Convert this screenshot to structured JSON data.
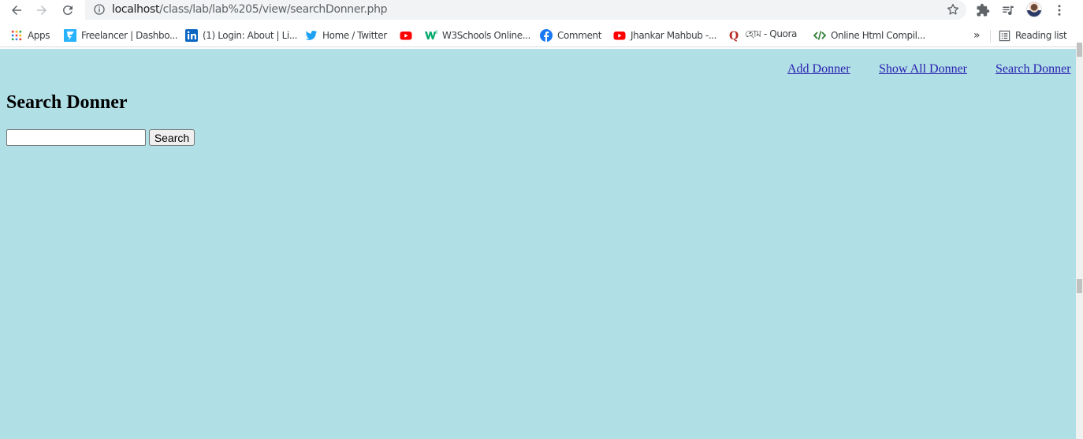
{
  "browser": {
    "url_host": "localhost",
    "url_path": "/class/lab/lab%205/view/searchDonner.php",
    "bookmarks": [
      {
        "label": "Apps",
        "icon": "apps-grid-icon"
      },
      {
        "label": "Freelancer | Dashbo...",
        "icon": "freelancer-icon"
      },
      {
        "label": "(1) Login: About | Li...",
        "icon": "linkedin-icon"
      },
      {
        "label": "Home / Twitter",
        "icon": "twitter-icon"
      },
      {
        "label": "",
        "icon": "youtube-icon"
      },
      {
        "label": "W3Schools Online...",
        "icon": "w3schools-icon"
      },
      {
        "label": "Comment",
        "icon": "facebook-icon"
      },
      {
        "label": "Jhankar Mahbub -...",
        "icon": "youtube-icon"
      },
      {
        "label": "হোম - Quora",
        "icon": "quora-icon"
      },
      {
        "label": "Online Html Compil...",
        "icon": "code-icon"
      }
    ],
    "overflow_label": "»",
    "reading_list_label": "Reading list"
  },
  "page": {
    "nav": {
      "add": "Add Donner",
      "show_all": "Show All Donner",
      "search": "Search Donner"
    },
    "title": "Search Donner",
    "search": {
      "value": "",
      "button_label": "Search"
    }
  },
  "colors": {
    "page_background": "#b0dfe5",
    "link": "#2a1fb0"
  }
}
